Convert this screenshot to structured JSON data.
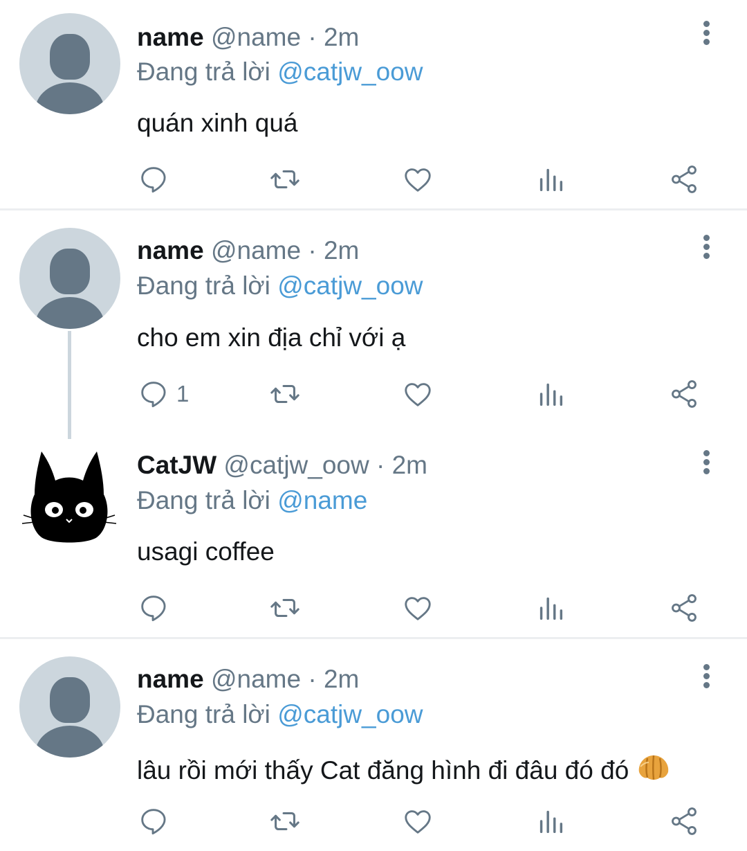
{
  "tweets": [
    {
      "author": "name",
      "handle": "@name",
      "time": "2m",
      "reply_label": "Đang trả lời",
      "reply_to": "@catjw_oow",
      "text": "quán xinh quá",
      "reply_count": ""
    },
    {
      "author": "name",
      "handle": "@name",
      "time": "2m",
      "reply_label": "Đang trả lời",
      "reply_to": "@catjw_oow",
      "text": "cho em xin địa chỉ với ạ",
      "reply_count": "1"
    },
    {
      "author": "CatJW",
      "handle": "@catjw_oow",
      "time": "2m",
      "reply_label": "Đang trả lời",
      "reply_to": "@name",
      "text": "usagi coffee",
      "reply_count": ""
    },
    {
      "author": "name",
      "handle": "@name",
      "time": "2m",
      "reply_label": "Đang trả lời",
      "reply_to": "@catjw_oow",
      "text": "lâu rồi mới thấy Cat đăng hình đi đâu đó đó",
      "reply_count": ""
    }
  ],
  "separator": "·",
  "icons": {
    "reply": "reply-icon",
    "retweet": "retweet-icon",
    "like": "heart-icon",
    "analytics": "analytics-icon",
    "share": "share-icon",
    "more": "more-vertical-icon",
    "emoji": "croissant-emoji"
  },
  "colors": {
    "mention": "#4a9bd6",
    "secondary_text": "#657786",
    "primary_text": "#14171a",
    "avatar_bg": "#ccd6dd"
  }
}
